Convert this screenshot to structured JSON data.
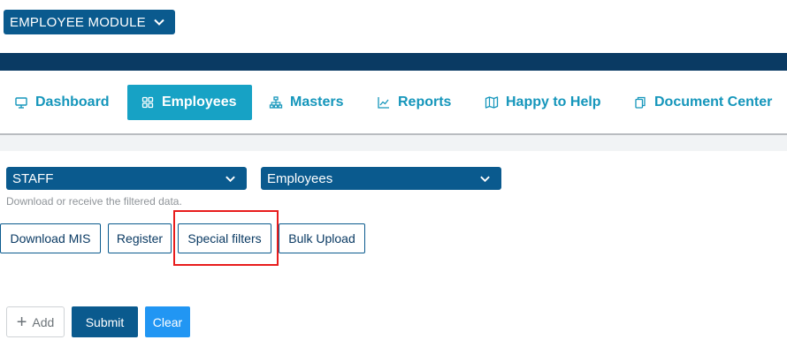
{
  "module": {
    "label": "EMPLOYEE MODULE",
    "icon": "chevron-down-icon"
  },
  "nav": {
    "tabs": [
      {
        "label": "Dashboard",
        "icon": "monitor-icon"
      },
      {
        "label": "Employees",
        "icon": "grid-icon",
        "active": true
      },
      {
        "label": "Masters",
        "icon": "hierarchy-icon"
      },
      {
        "label": "Reports",
        "icon": "line-chart-icon"
      },
      {
        "label": "Happy to Help",
        "icon": "map-icon"
      },
      {
        "label": "Document Center",
        "icon": "documents-icon"
      }
    ]
  },
  "filters": {
    "category_value": "STAFF",
    "dataset_value": "Employees",
    "hint": "Download or receive the filtered data."
  },
  "actions": {
    "download_mis": "Download MIS",
    "register": "Register",
    "special_filters": "Special filters",
    "bulk_upload": "Bulk Upload"
  },
  "form": {
    "add_label": "Add",
    "submit_label": "Submit",
    "clear_label": "Clear"
  },
  "colors": {
    "primary": "#0a5a8e",
    "navy_band": "#0a3a63",
    "tab_active": "#17a2c5",
    "tab_text": "#1596bb",
    "clear_button": "#2196f3",
    "highlight": "#e81c1c"
  }
}
